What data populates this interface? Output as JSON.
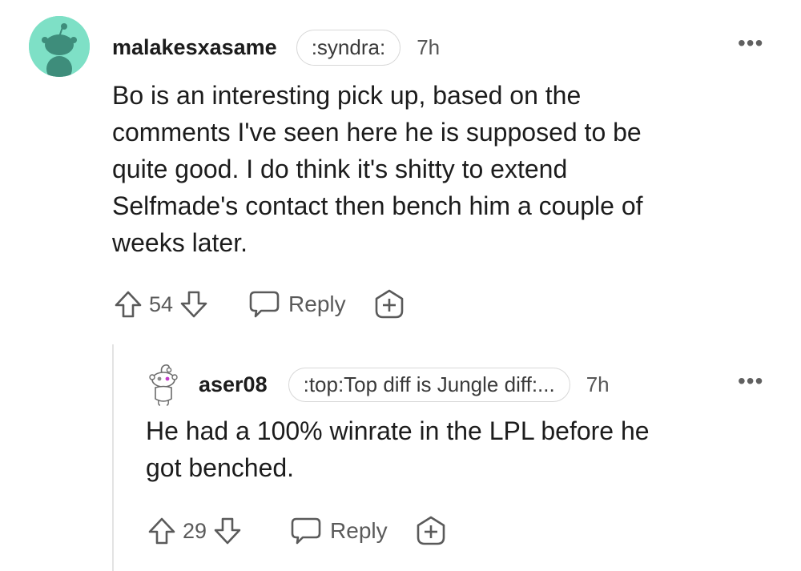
{
  "comment": {
    "username": "malakesxasame",
    "flair": ":syndra:",
    "time": "7h",
    "more_label": "•••",
    "body": "Bo is an interesting pick up, based on the\ncomments I've seen here he is supposed to be\nquite good. I do think it's shitty to extend\nSelfmade's contact then bench him a couple of\nweeks later.",
    "vote_count": "54",
    "reply_label": "Reply",
    "avatar_icon": "snoo-avatar-icon",
    "avatar_color": "#7ee0c6"
  },
  "reply": {
    "username": "aser08",
    "flair": ":top:Top diff is Jungle diff:...",
    "time": "7h",
    "more_label": "•••",
    "body": "He had a 100% winrate in the LPL before he\ngot benched.",
    "vote_count": "29",
    "reply_label": "Reply",
    "avatar_icon": "snoo-avatar-icon"
  },
  "icons": {
    "upvote": "upvote-arrow-icon",
    "downvote": "downvote-arrow-icon",
    "reply": "speech-bubble-icon",
    "award": "award-plus-icon",
    "more": "ellipsis-icon"
  }
}
